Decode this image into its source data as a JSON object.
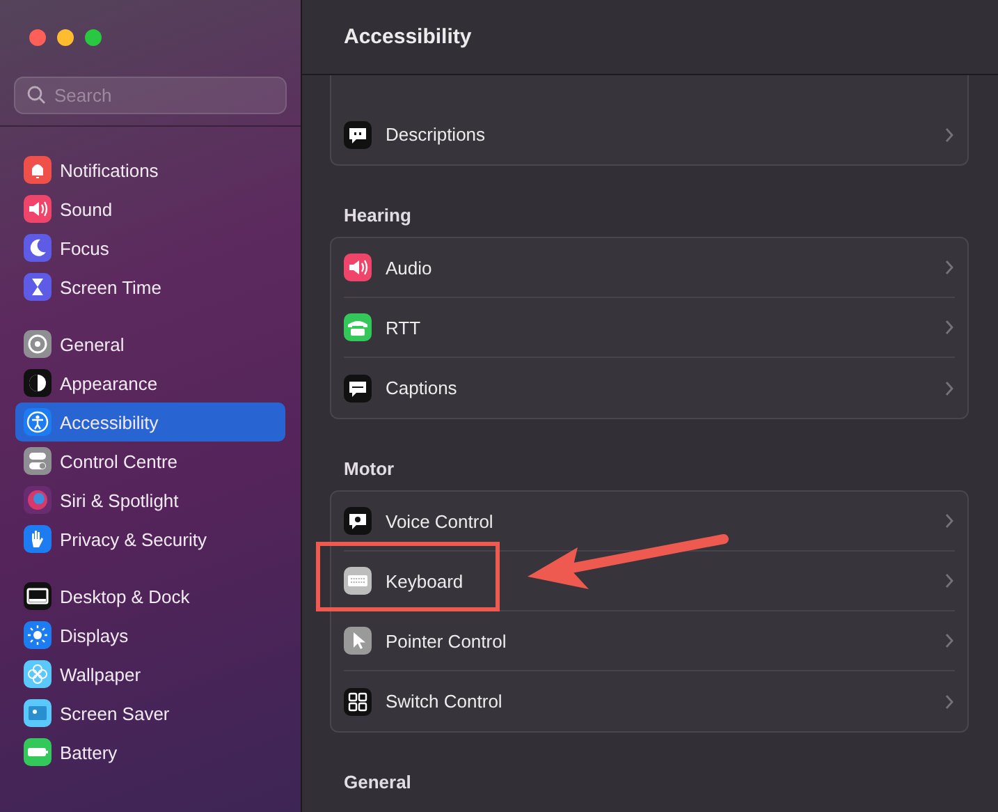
{
  "search": {
    "placeholder": "Search"
  },
  "sidebar": {
    "groups": [
      {
        "items": [
          {
            "label": "Notifications",
            "selected": false
          },
          {
            "label": "Sound",
            "selected": false
          },
          {
            "label": "Focus",
            "selected": false
          },
          {
            "label": "Screen Time",
            "selected": false
          }
        ]
      },
      {
        "items": [
          {
            "label": "General",
            "selected": false
          },
          {
            "label": "Appearance",
            "selected": false
          },
          {
            "label": "Accessibility",
            "selected": true
          },
          {
            "label": "Control Centre",
            "selected": false
          },
          {
            "label": "Siri & Spotlight",
            "selected": false
          },
          {
            "label": "Privacy & Security",
            "selected": false
          }
        ]
      },
      {
        "items": [
          {
            "label": "Desktop & Dock",
            "selected": false
          },
          {
            "label": "Displays",
            "selected": false
          },
          {
            "label": "Wallpaper",
            "selected": false
          },
          {
            "label": "Screen Saver",
            "selected": false
          },
          {
            "label": "Battery",
            "selected": false
          }
        ]
      }
    ]
  },
  "title": "Accessibility",
  "sections": [
    {
      "rows": [
        {
          "label": "Descriptions",
          "highlighted": false
        }
      ]
    },
    {
      "heading": "Hearing",
      "rows": [
        {
          "label": "Audio",
          "highlighted": false
        },
        {
          "label": "RTT",
          "highlighted": false
        },
        {
          "label": "Captions",
          "highlighted": false
        }
      ]
    },
    {
      "heading": "Motor",
      "rows": [
        {
          "label": "Voice Control",
          "highlighted": false
        },
        {
          "label": "Keyboard",
          "highlighted": true
        },
        {
          "label": "Pointer Control",
          "highlighted": false
        },
        {
          "label": "Switch Control",
          "highlighted": false
        }
      ]
    },
    {
      "heading": "General"
    }
  ]
}
